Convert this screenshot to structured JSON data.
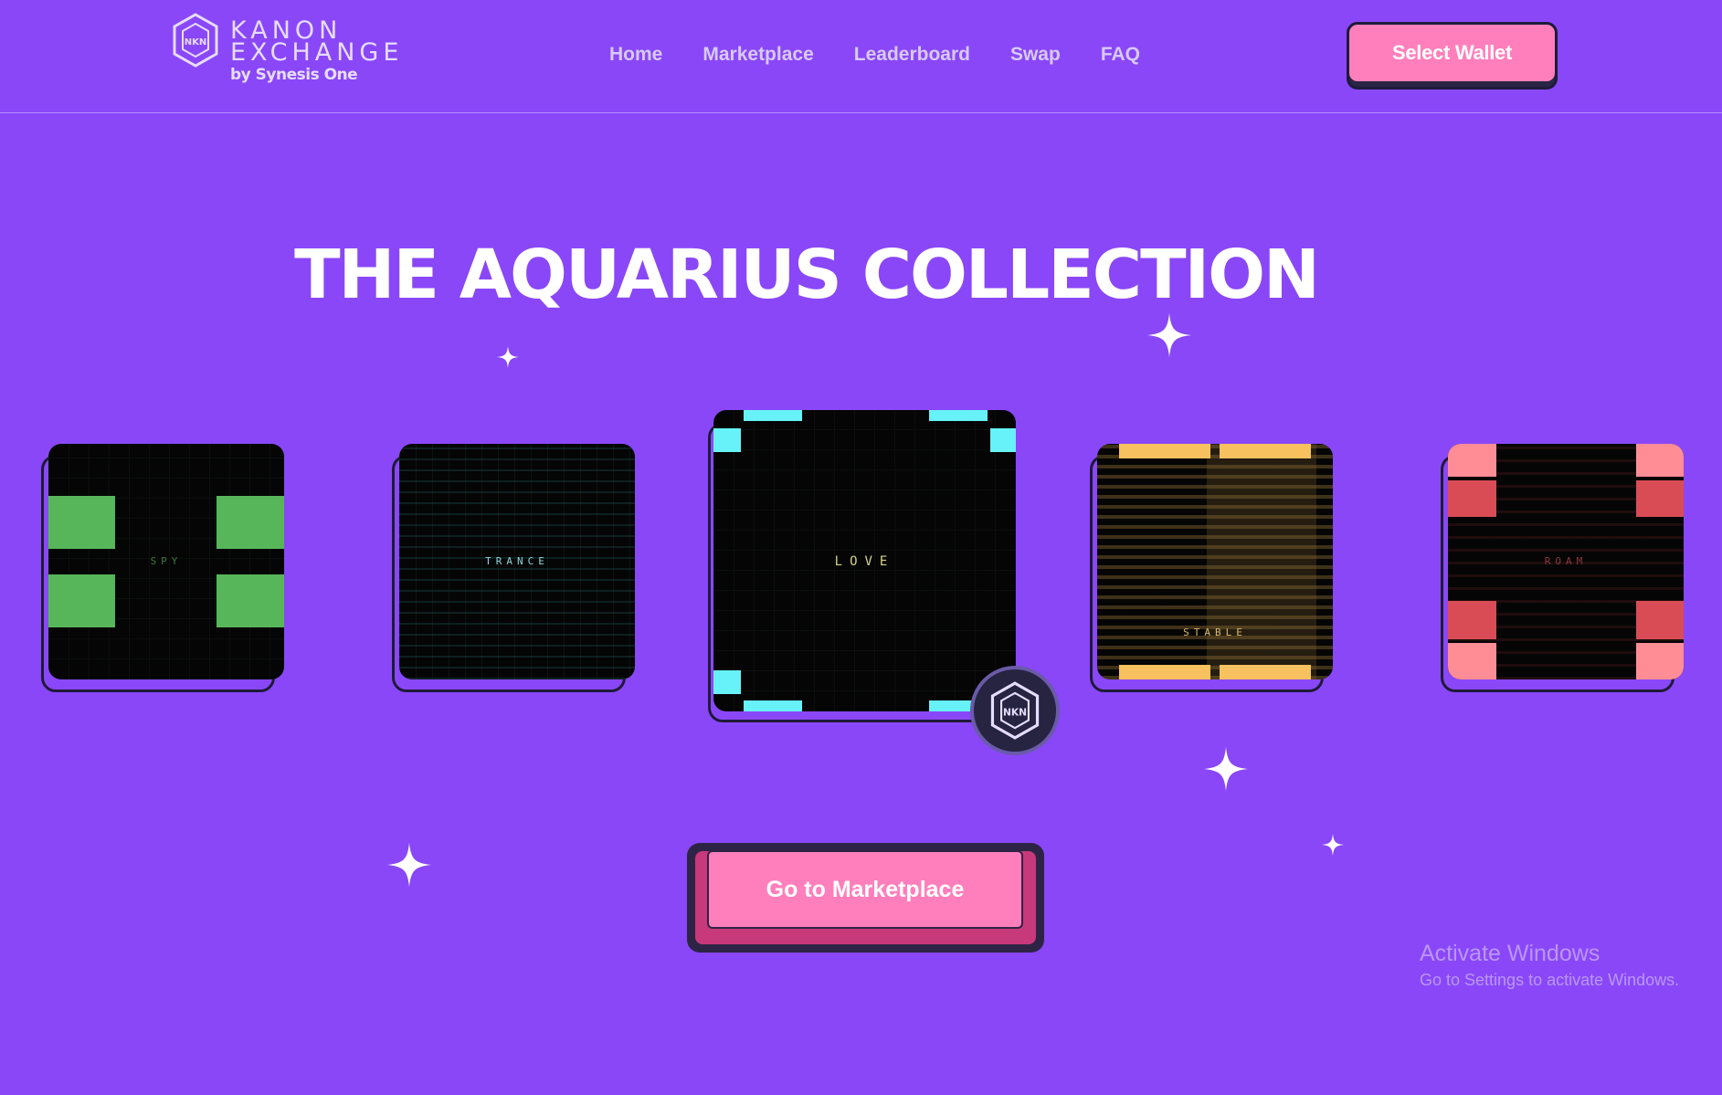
{
  "header": {
    "logo": {
      "line1": "KANON",
      "line2": "EXCHANGE",
      "sub": "by Synesis One"
    },
    "nav": [
      {
        "label": "Home"
      },
      {
        "label": "Marketplace"
      },
      {
        "label": "Leaderboard"
      },
      {
        "label": "Swap"
      },
      {
        "label": "FAQ"
      }
    ],
    "wallet_button": "Select Wallet"
  },
  "hero": {
    "title": "THE AQUARIUS COLLECTION"
  },
  "cards": [
    {
      "word": "SPY",
      "color": "#57b65a"
    },
    {
      "word": "TRANCE",
      "color": "#3ea6a6"
    },
    {
      "word": "LOVE",
      "color": "#66f2f8"
    },
    {
      "word": "STABLE",
      "color": "#f8c15f"
    },
    {
      "word": "ROAM",
      "color": "#d94c55"
    }
  ],
  "badge_icon": "kanon-hex-icon",
  "cta": {
    "label": "Go to Marketplace"
  },
  "watermark": {
    "line1": "Activate Windows",
    "line2": "Go to Settings to activate Windows."
  },
  "colors": {
    "background": "#8a47f8",
    "accent_pink": "#ff7fbc",
    "dark": "#1d1b3a"
  }
}
